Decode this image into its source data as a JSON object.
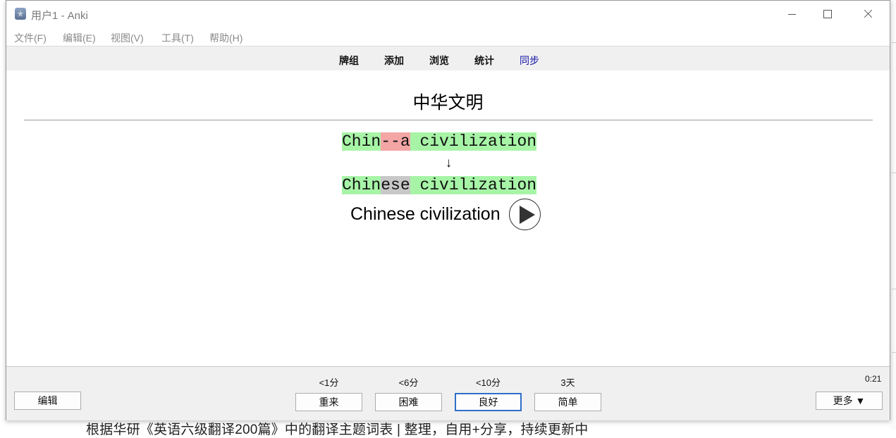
{
  "window": {
    "title": "用户1 - Anki"
  },
  "menu": [
    "文件(F)",
    "编辑(E)",
    "视图(V)",
    "工具(T)",
    "帮助(H)"
  ],
  "toolbar": {
    "decks": "牌组",
    "add": "添加",
    "browse": "浏览",
    "stats": "统计",
    "sync": "同步",
    "sync_color": "#1010a8"
  },
  "card": {
    "front": "中华文明",
    "typed": {
      "seg1": "Chin",
      "seg2": "--a",
      "seg3": " civilization"
    },
    "arrow": "↓",
    "correct": {
      "seg1": "Chin",
      "seg2": "ese",
      "seg3": " civilization"
    },
    "answer": "Chinese civilization",
    "colors": {
      "match": "#a7f4a7",
      "wrong": "#f4a5a5",
      "missing": "#c8c8c8"
    }
  },
  "review": {
    "edit": "编辑",
    "more": "更多 ▼",
    "timer": "0:21",
    "buttons": [
      {
        "label": "重来",
        "interval": "<1分"
      },
      {
        "label": "困难",
        "interval": "<6分"
      },
      {
        "label": "良好",
        "interval": "<10分"
      },
      {
        "label": "简单",
        "interval": "3天"
      }
    ],
    "focus_color": "#2e6fc9"
  },
  "background": {
    "bottom_text": "根据华研《英语六级翻译200篇》中的翻译主题词表 | 整理，自用+分享，持续更新中"
  }
}
